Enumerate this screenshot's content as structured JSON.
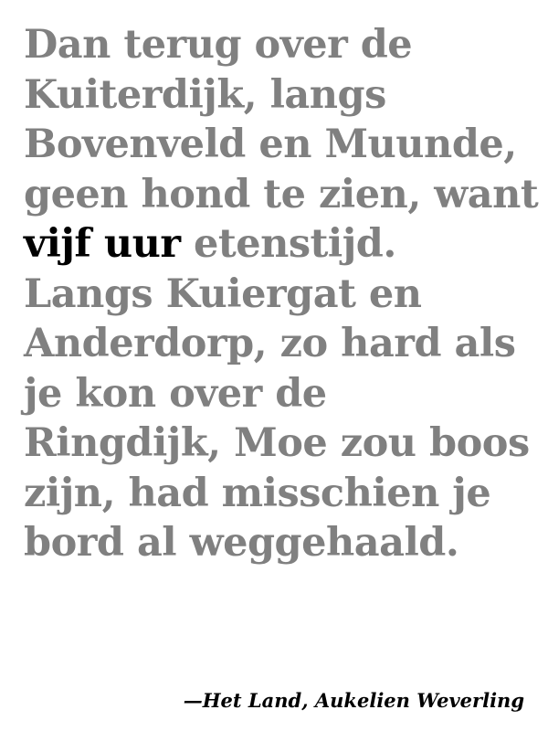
{
  "poem": {
    "lines": [
      "Dan terug over de",
      "Kuiterdijk, langs",
      "Bovenveld en Muunde,",
      "geen hond te zien, want",
      "",
      "Langs Kuiergat en",
      "Anderdorp, zo hard als",
      "je kon over de",
      "Ringdijk, Moe zou boos",
      "zijn, had misschien je",
      "bord al weggehaald."
    ],
    "highlight_line": {
      "emphasis": "vijf uur",
      "rest": " etenstijd."
    }
  },
  "attribution": "—Het Land, Aukelien Weverling",
  "colors": {
    "body_text": "#808080",
    "emphasis_text": "#000000",
    "background": "#ffffff"
  }
}
